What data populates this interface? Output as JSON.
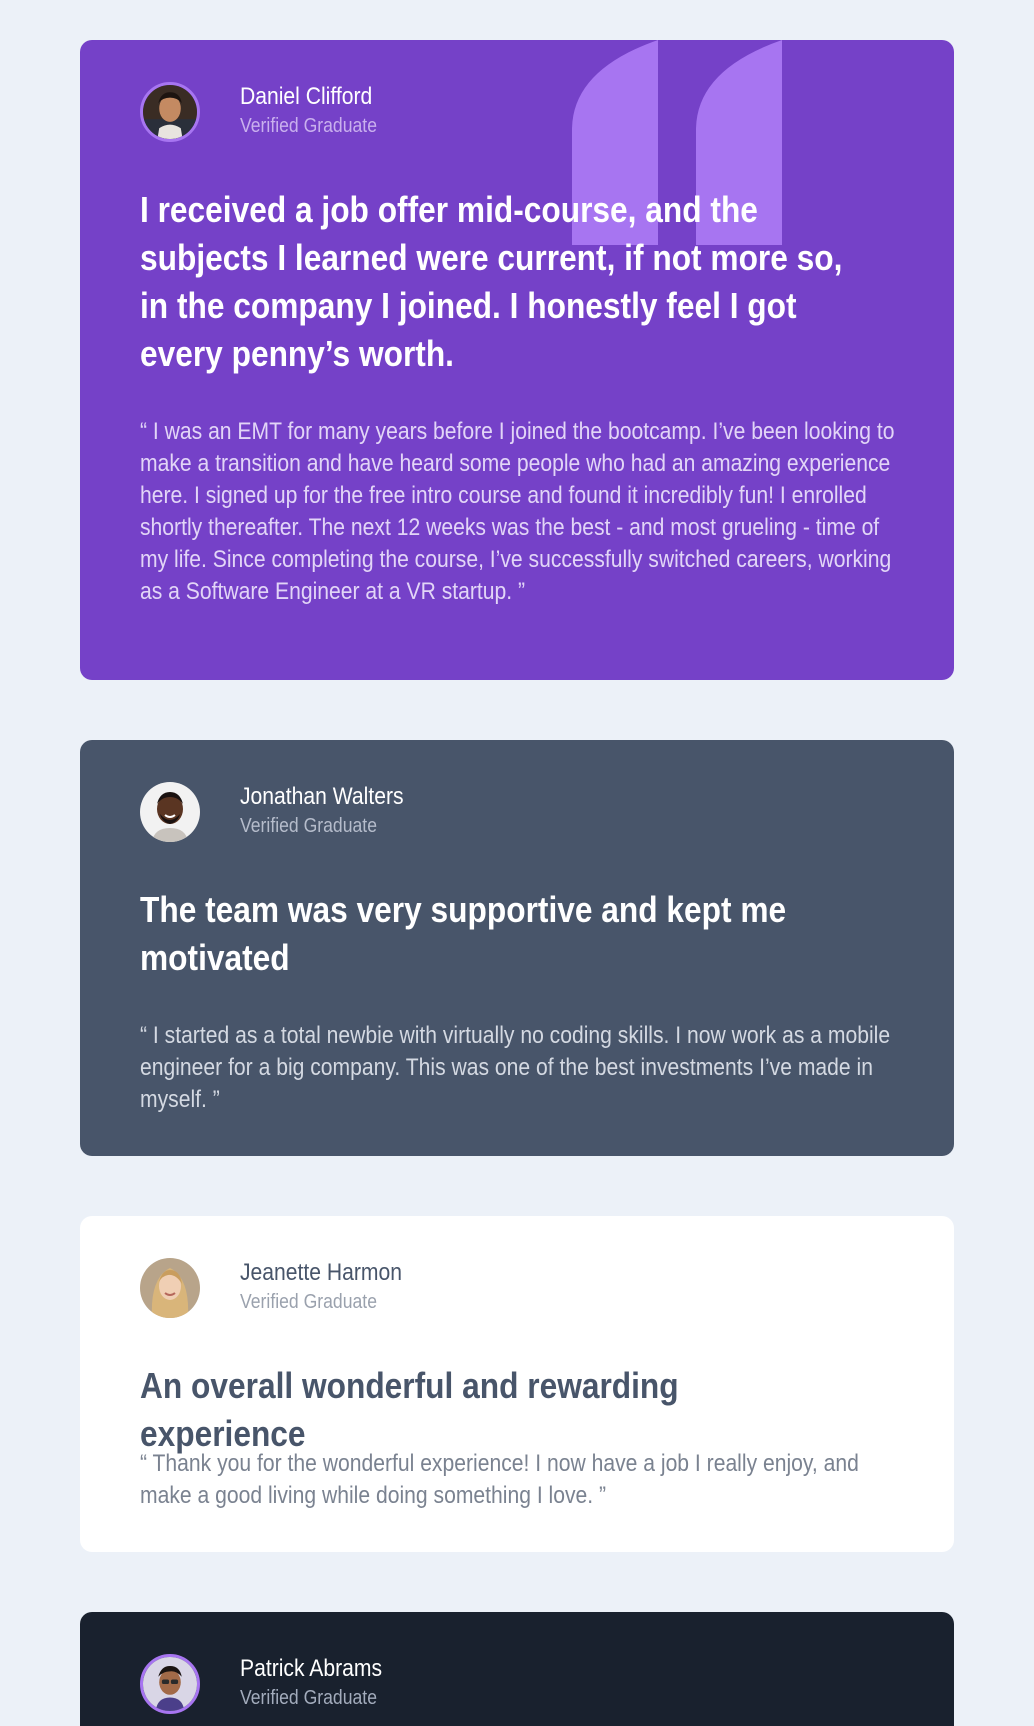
{
  "colors": {
    "page_background": "#ecf1f8",
    "purple": "#7541c8",
    "light_purple": "#a775f1",
    "grayish_blue": "#48556a",
    "white": "#ffffff",
    "very_dark_blue": "#19212e"
  },
  "testimonials": [
    {
      "name": "Daniel Clifford",
      "role": "Verified Graduate",
      "headline": "I received a job offer mid-course, and the subjects I learned were current, if not more so, in the company I joined. I honestly feel I got every penny’s worth.",
      "quote": "“ I was an EMT for many years before I joined the bootcamp. I’ve been looking to make a transition and have heard some people who had an amazing experience here. I signed up for the free intro course and found it incredibly fun! I enrolled shortly thereafter. The next 12 weeks was the best - and most grueling - time of my life. Since completing the course, I’ve successfully switched careers, working as a Software Engineer at a VR startup. ”",
      "background": "#7541c8",
      "avatar_icon": "avatar-daniel-icon"
    },
    {
      "name": "Jonathan Walters",
      "role": "Verified Graduate",
      "headline": "The team was very supportive and kept me motivated",
      "quote": "“ I started as a total newbie with virtually no coding skills. I now work as a mobile engineer for a big company. This was one of the best investments I’ve made in myself. ”",
      "background": "#48556a",
      "avatar_icon": "avatar-jonathan-icon"
    },
    {
      "name": "Jeanette Harmon",
      "role": "Verified Graduate",
      "headline": "An overall wonderful and rewarding experience",
      "quote": "“ Thank you for the wonderful experience! I now have a job I really enjoy, and make a good living while doing something I love. ”",
      "background": "#ffffff",
      "avatar_icon": "avatar-jeanette-icon"
    },
    {
      "name": "Patrick Abrams",
      "role": "Verified Graduate",
      "background": "#19212e",
      "avatar_icon": "avatar-patrick-icon"
    }
  ],
  "decoration": {
    "quote_icon": "quotation-mark-icon"
  }
}
